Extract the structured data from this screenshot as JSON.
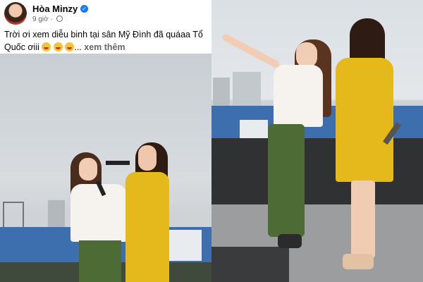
{
  "post": {
    "author": "Hòa Minzy",
    "time": "9 giờ",
    "meta_separator": "·",
    "text": "Trời ơi xem diễu binh tại sân Mỹ Đình đã quáaa Tổ Quốc ơiii",
    "ellipsis": "...",
    "see_more": "xem thêm",
    "emoji_count": 3
  },
  "icons": {
    "verified": "verified-badge-icon",
    "privacy": "globe-icon",
    "reaction": "grinning-tongue-emoji"
  },
  "colors": {
    "name": "#050505",
    "meta": "#65676b",
    "verified": "#1877f2",
    "stadium_seats": "#3d6fae",
    "yellow_dress": "#e5b81c",
    "green_pants": "#4d6b35"
  }
}
